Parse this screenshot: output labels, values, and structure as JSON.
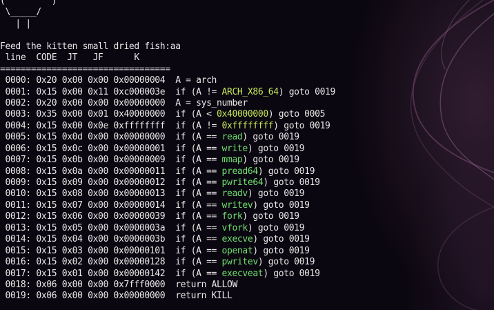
{
  "colors": {
    "background": "#0b0710",
    "text": "#e8e8e8",
    "arch_highlight": "#c5e85a",
    "syscall_highlight": "#6fe06f"
  },
  "art": [
    "(         )^^^^",
    " \\_____/",
    "   | |"
  ],
  "prompt": "Feed the kitten small dried fish:aa",
  "header": " line  CODE  JT   JF      K",
  "separator": "=================================",
  "rows": [
    {
      "prefix": " 0000: 0x20 0x00 0x00 0x00000004  A = arch",
      "hl": "",
      "suffix": ""
    },
    {
      "prefix": " 0001: 0x15 0x00 0x11 0xc000003e  if (A != ",
      "hl": "ARCH_X86_64",
      "suffix": ") goto 0019"
    },
    {
      "prefix": " 0002: 0x20 0x00 0x00 0x00000000  A = sys_number",
      "hl": "",
      "suffix": ""
    },
    {
      "prefix": " 0003: 0x35 0x00 0x01 0x40000000  if (A < ",
      "hl": "0x40000000",
      "suffix": ") goto 0005"
    },
    {
      "prefix": " 0004: 0x15 0x00 0x0e 0xffffffff  if (A != ",
      "hl": "0xffffffff",
      "suffix": ") goto 0019"
    },
    {
      "prefix": " 0005: 0x15 0x0d 0x00 0x00000000  if (A == ",
      "sys": "read",
      "suffix": ") goto 0019"
    },
    {
      "prefix": " 0006: 0x15 0x0c 0x00 0x00000001  if (A == ",
      "sys": "write",
      "suffix": ") goto 0019"
    },
    {
      "prefix": " 0007: 0x15 0x0b 0x00 0x00000009  if (A == ",
      "sys": "mmap",
      "suffix": ") goto 0019"
    },
    {
      "prefix": " 0008: 0x15 0x0a 0x00 0x00000011  if (A == ",
      "sys": "pread64",
      "suffix": ") goto 0019"
    },
    {
      "prefix": " 0009: 0x15 0x09 0x00 0x00000012  if (A == ",
      "sys": "pwrite64",
      "suffix": ") goto 0019"
    },
    {
      "prefix": " 0010: 0x15 0x08 0x00 0x00000013  if (A == ",
      "sys": "readv",
      "suffix": ") goto 0019"
    },
    {
      "prefix": " 0011: 0x15 0x07 0x00 0x00000014  if (A == ",
      "sys": "writev",
      "suffix": ") goto 0019"
    },
    {
      "prefix": " 0012: 0x15 0x06 0x00 0x00000039  if (A == ",
      "sys": "fork",
      "suffix": ") goto 0019"
    },
    {
      "prefix": " 0013: 0x15 0x05 0x00 0x0000003a  if (A == ",
      "sys": "vfork",
      "suffix": ") goto 0019"
    },
    {
      "prefix": " 0014: 0x15 0x04 0x00 0x0000003b  if (A == ",
      "sys": "execve",
      "suffix": ") goto 0019"
    },
    {
      "prefix": " 0015: 0x15 0x03 0x00 0x00000101  if (A == ",
      "sys": "openat",
      "suffix": ") goto 0019"
    },
    {
      "prefix": " 0016: 0x15 0x02 0x00 0x00000128  if (A == ",
      "sys": "pwritev",
      "suffix": ") goto 0019"
    },
    {
      "prefix": " 0017: 0x15 0x01 0x00 0x00000142  if (A == ",
      "sys": "execveat",
      "suffix": ") goto 0019"
    },
    {
      "prefix": " 0018: 0x06 0x00 0x00 0x7fff0000  return ALLOW",
      "hl": "",
      "suffix": ""
    },
    {
      "prefix": " 0019: 0x06 0x00 0x00 0x00000000  return KILL",
      "hl": "",
      "suffix": ""
    }
  ]
}
